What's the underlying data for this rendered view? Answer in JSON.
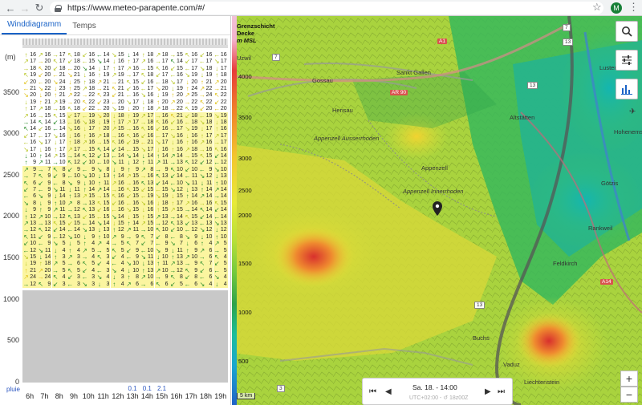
{
  "browser": {
    "url": "https://www.meteo-parapente.com/#/",
    "avatar": "M"
  },
  "tabs": [
    "Winddiagramm",
    "Temps"
  ],
  "diagram": {
    "unit_label": "(m)",
    "y_ticks": [
      "3500",
      "3000",
      "2500",
      "2000",
      "1500",
      "1000",
      "500",
      "0"
    ],
    "rain_label": "pluie",
    "hours": [
      "6h",
      "7h",
      "8h",
      "9h",
      "10h",
      "11h",
      "12h",
      "13h",
      "14h",
      "15h",
      "16h",
      "17h",
      "18h",
      "19h"
    ],
    "rain_values": [
      "",
      "",
      "",
      "",
      "",
      "",
      "",
      "0.1",
      "0.1",
      "2.1",
      "",
      "",
      "",
      ""
    ],
    "rows": [
      [
        "16",
        "16",
        "17",
        "18",
        "16",
        "14",
        "15",
        "14",
        "18",
        "18",
        "15",
        "16",
        "16",
        "16"
      ],
      [
        "17",
        "20",
        "17",
        "18",
        "15",
        "14",
        "16",
        "17",
        "16",
        "17",
        "14",
        "17",
        "17",
        "17"
      ],
      [
        "18",
        "20",
        "18",
        "20",
        "14",
        "17",
        "17",
        "16",
        "15",
        "16",
        "15",
        "17",
        "18",
        "17"
      ],
      [
        "19",
        "20",
        "21",
        "21",
        "16",
        "19",
        "19",
        "17",
        "18",
        "17",
        "16",
        "19",
        "19",
        "18"
      ],
      [
        "20",
        "20",
        "24",
        "25",
        "18",
        "21",
        "21",
        "15",
        "16",
        "18",
        "17",
        "20",
        "21",
        "20"
      ],
      [
        "21",
        "22",
        "23",
        "25",
        "18",
        "21",
        "21",
        "16",
        "17",
        "20",
        "19",
        "24",
        "22",
        "21"
      ],
      [
        "20",
        "20",
        "21",
        "22",
        "22",
        "23",
        "21",
        "16",
        "16",
        "19",
        "20",
        "25",
        "24",
        "22"
      ],
      [
        "19",
        "21",
        "19",
        "20",
        "22",
        "23",
        "20",
        "17",
        "18",
        "20",
        "20",
        "22",
        "22",
        "22"
      ],
      [
        "17",
        "18",
        "16",
        "18",
        "22",
        "20",
        "19",
        "20",
        "18",
        "18",
        "22",
        "19",
        "20",
        "20"
      ],
      [
        "16",
        "15",
        "15",
        "17",
        "19",
        "20",
        "18",
        "19",
        "17",
        "16",
        "21",
        "18",
        "19",
        "19"
      ],
      [
        "14",
        "14",
        "13",
        "16",
        "18",
        "19",
        "17",
        "17",
        "18",
        "16",
        "16",
        "18",
        "18",
        "18"
      ],
      [
        "14",
        "16",
        "14",
        "16",
        "17",
        "20",
        "15",
        "16",
        "16",
        "16",
        "17",
        "19",
        "17",
        "16"
      ],
      [
        "17",
        "17",
        "16",
        "16",
        "16",
        "18",
        "16",
        "16",
        "16",
        "17",
        "16",
        "16",
        "17",
        "17"
      ],
      [
        "16",
        "17",
        "17",
        "18",
        "16",
        "15",
        "16",
        "19",
        "21",
        "17",
        "16",
        "16",
        "16",
        "17"
      ],
      [
        "17",
        "16",
        "17",
        "17",
        "15",
        "14",
        "14",
        "15",
        "17",
        "16",
        "16",
        "18",
        "16",
        "16"
      ],
      [
        "10",
        "14",
        "15",
        "14",
        "12",
        "13",
        "14",
        "14",
        "14",
        "14",
        "14",
        "15",
        "15",
        "14"
      ],
      [
        "9",
        "11",
        "10",
        "12",
        "10",
        "10",
        "11",
        "12",
        "11",
        "11",
        "13",
        "12",
        "12",
        "12"
      ],
      [
        "9",
        "7",
        "8",
        "9",
        "9",
        "8",
        "9",
        "9",
        "8",
        "9",
        "10",
        "10",
        "9",
        "10"
      ],
      [
        "7",
        "9",
        "9",
        "10",
        "10",
        "13",
        "14",
        "15",
        "16",
        "13",
        "14",
        "11",
        "12",
        "13"
      ],
      [
        "6",
        "9",
        "8",
        "9",
        "10",
        "11",
        "16",
        "16",
        "13",
        "14",
        "10",
        "11",
        "11",
        "10"
      ],
      [
        "7",
        "9",
        "11",
        "11",
        "14",
        "14",
        "16",
        "15",
        "15",
        "15",
        "12",
        "13",
        "14",
        "14"
      ],
      [
        "6",
        "9",
        "14",
        "13",
        "15",
        "15",
        "16",
        "15",
        "19",
        "19",
        "15",
        "14",
        "14",
        "14"
      ],
      [
        "8",
        "9",
        "10",
        "8",
        "13",
        "15",
        "16",
        "16",
        "16",
        "18",
        "17",
        "16",
        "16",
        "15"
      ],
      [
        "9",
        "9",
        "11",
        "12",
        "13",
        "16",
        "16",
        "15",
        "16",
        "15",
        "15",
        "14",
        "14",
        "14"
      ],
      [
        "12",
        "10",
        "12",
        "13",
        "15",
        "15",
        "14",
        "15",
        "15",
        "13",
        "14",
        "15",
        "14",
        "14"
      ],
      [
        "13",
        "13",
        "15",
        "15",
        "14",
        "14",
        "15",
        "14",
        "15",
        "12",
        "13",
        "13",
        "13",
        "13"
      ],
      [
        "12",
        "12",
        "14",
        "14",
        "13",
        "13",
        "12",
        "11",
        "10",
        "10",
        "10",
        "12",
        "12",
        "12"
      ],
      [
        "11",
        "9",
        "12",
        "10",
        "9",
        "10",
        "9",
        "9",
        "7",
        "8",
        "8",
        "9",
        "10",
        "10"
      ],
      [
        "10",
        "9",
        "5",
        "5",
        "4",
        "4",
        "5",
        "7",
        "7",
        "9",
        "7",
        "6",
        "4",
        "5"
      ],
      [
        "12",
        "11",
        "4",
        "4",
        "5",
        "5",
        "5",
        "9",
        "10",
        "9",
        "11",
        "9",
        "6",
        "5"
      ],
      [
        "15",
        "14",
        "3",
        "3",
        "4",
        "3",
        "4",
        "9",
        "11",
        "10",
        "13",
        "10",
        "6",
        "4"
      ],
      [
        "19",
        "18",
        "5",
        "6",
        "5",
        "4",
        "4",
        "10",
        "13",
        "11",
        "13",
        "9",
        "7",
        "5"
      ],
      [
        "21",
        "20",
        "5",
        "5",
        "4",
        "3",
        "4",
        "10",
        "13",
        "10",
        "12",
        "9",
        "6",
        "5"
      ],
      [
        "24",
        "24",
        "4",
        "3",
        "3",
        "4",
        "3",
        "8",
        "10",
        "9",
        "8",
        "8",
        "6",
        "4"
      ],
      [
        "12",
        "9",
        "3",
        "3",
        "3",
        "3",
        "4",
        "6",
        "6",
        "6",
        "5",
        "6",
        "4",
        "4"
      ]
    ]
  },
  "map": {
    "legend_title": [
      "Grenzschicht",
      "Decke",
      "m MSL"
    ],
    "legend_alts": [
      "4000",
      "3500",
      "3000",
      "2500",
      "2000",
      "1500",
      "1000",
      "500"
    ],
    "places": [
      {
        "name": "Uzwil",
        "up": true
      },
      {
        "name": "Gossau",
        "up": true
      },
      {
        "name": "Sankt Gallen",
        "up": true
      },
      {
        "name": "Herisau",
        "up": true
      },
      {
        "name": "Appenzell Ausserrhoden",
        "up": false
      },
      {
        "name": "Appenzell",
        "up": true
      },
      {
        "name": "Appenzell Innerrhoden",
        "up": false
      },
      {
        "name": "Altstätten",
        "up": true
      },
      {
        "name": "Götzis",
        "up": true
      },
      {
        "name": "Hohenems",
        "up": true
      },
      {
        "name": "Rankweil",
        "up": true
      },
      {
        "name": "Feldkirch",
        "up": true
      },
      {
        "name": "Lustenau",
        "up": true
      },
      {
        "name": "Buchs",
        "up": true
      },
      {
        "name": "Vaduz",
        "up": true
      },
      {
        "name": "Liechtenstein",
        "up": true
      }
    ],
    "roads": [
      "A1",
      "7",
      "AR 90",
      "13",
      "A14",
      "13",
      "7",
      "13",
      "3"
    ],
    "scale": "5 km",
    "time_date": "Sa. 18. - 14:00",
    "time_sub": "UTC+02:00 - ↺ 18z00Z"
  }
}
